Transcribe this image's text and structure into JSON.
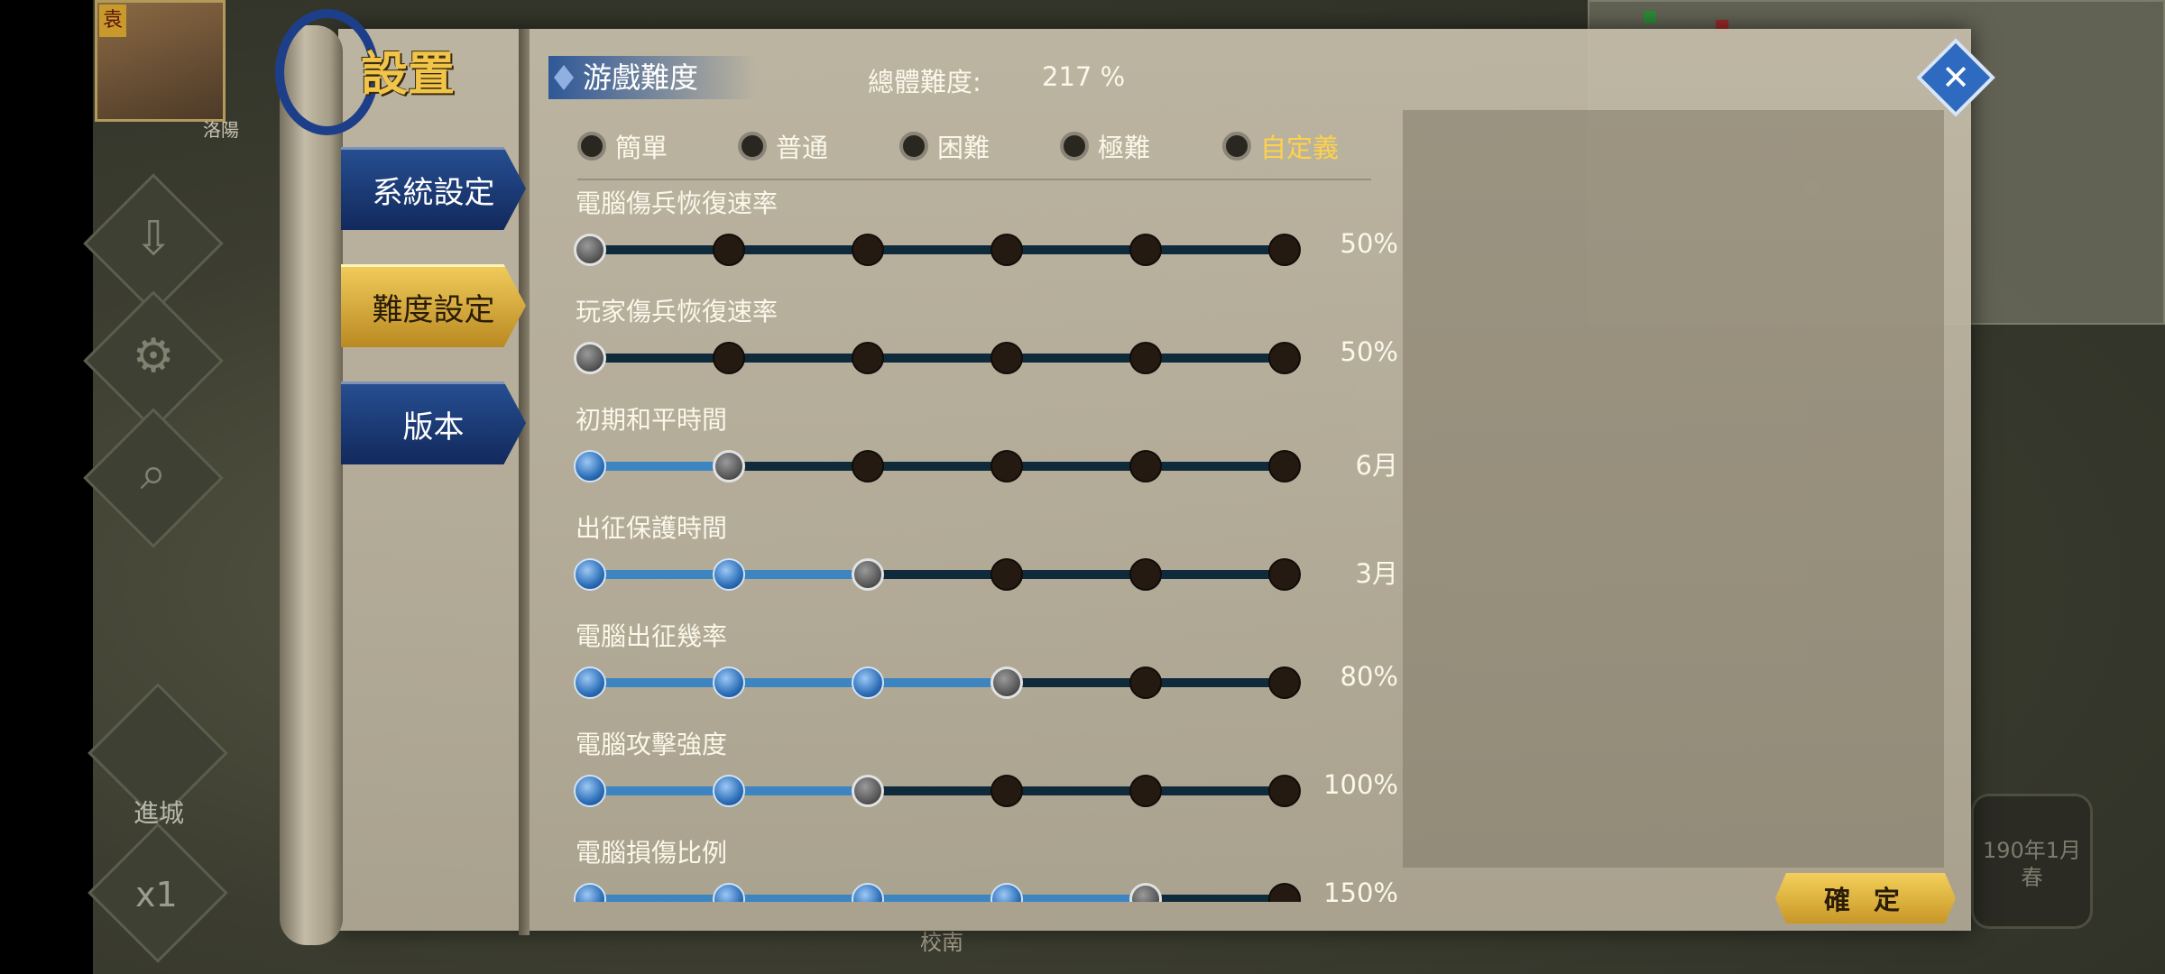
{
  "background": {
    "portrait_badge": "袁",
    "place_label": "洛陽",
    "enter_city_label": "進城",
    "speed_label": "x1",
    "date_label": "190年1月\n春",
    "bottom_label": "校南"
  },
  "sidebar": {
    "title": "設置",
    "tabs": [
      {
        "label": "系統設定",
        "active": false
      },
      {
        "label": "難度設定",
        "active": true
      },
      {
        "label": "版本",
        "active": false
      }
    ]
  },
  "header": {
    "section_title": "游戲難度",
    "total_label": "總體難度:",
    "total_value": "217 %"
  },
  "presets": [
    {
      "label": "簡單",
      "selected": false
    },
    {
      "label": "普通",
      "selected": false
    },
    {
      "label": "困難",
      "selected": false
    },
    {
      "label": "極難",
      "selected": false
    },
    {
      "label": "自定義",
      "selected": true
    }
  ],
  "settings": [
    {
      "title": "電腦傷兵恢復速率",
      "value": "50%",
      "level": 0,
      "steps": 6
    },
    {
      "title": "玩家傷兵恢復速率",
      "value": "50%",
      "level": 0,
      "steps": 6
    },
    {
      "title": "初期和平時間",
      "value": "6月",
      "level": 1,
      "steps": 6
    },
    {
      "title": "出征保護時間",
      "value": "3月",
      "level": 2,
      "steps": 6
    },
    {
      "title": "電腦出征幾率",
      "value": "80%",
      "level": 3,
      "steps": 6
    },
    {
      "title": "電腦攻擊強度",
      "value": "100%",
      "level": 2,
      "steps": 6
    },
    {
      "title": "電腦損傷比例",
      "value": "150%",
      "level": 4,
      "steps": 6
    }
  ],
  "buttons": {
    "confirm": "確 定",
    "close": "✕"
  },
  "colors": {
    "accent_gold": "#ffd24a",
    "tab_blue": "#264e91",
    "slider_fill": "#3d85c0"
  }
}
